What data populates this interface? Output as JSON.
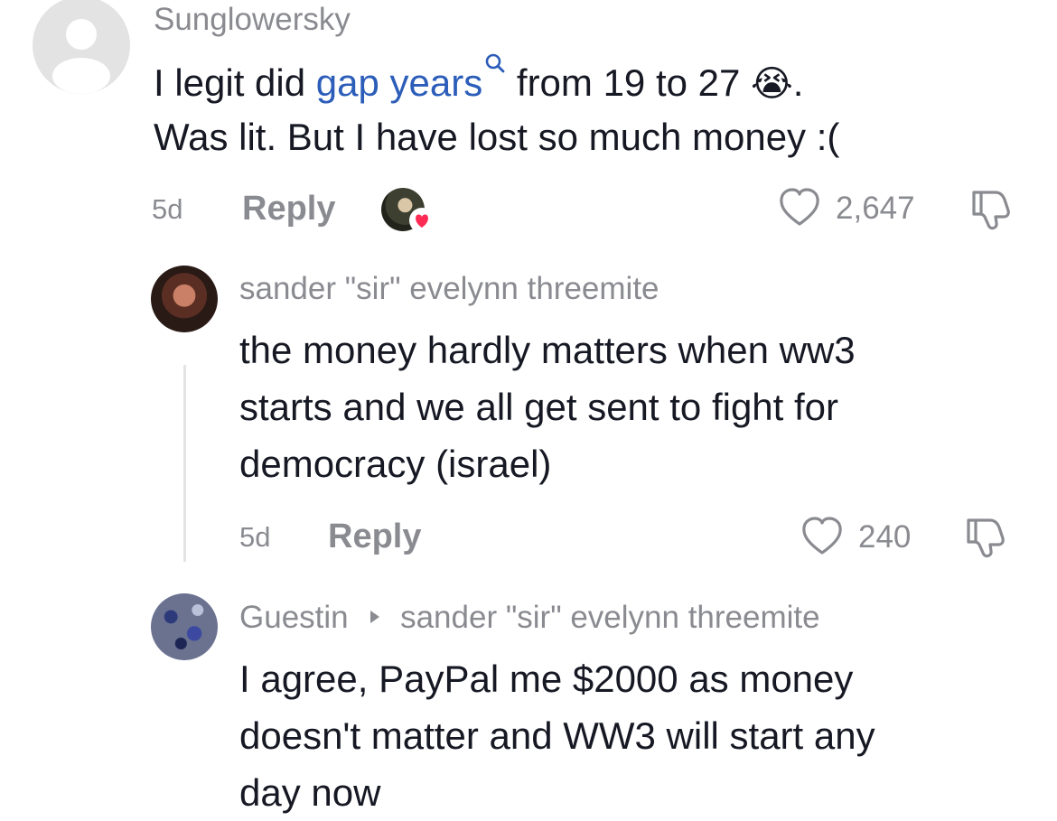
{
  "comments": [
    {
      "username": "Sunglowersky",
      "line1_prefix": "I legit did ",
      "link_text": "gap years",
      "line1_suffix": " from 19 to 27",
      "emoji": "😭",
      "line1_end": ".",
      "line2": "Was lit. But I have lost so much money :(",
      "time": "5d",
      "reply_label": "Reply",
      "likes": "2,647"
    },
    {
      "username": "sander \"sir\" evelynn threemite",
      "lines": [
        "the money hardly matters when ww3",
        "starts and we all get sent to fight for",
        "democracy (israel)"
      ],
      "time": "5d",
      "reply_label": "Reply",
      "likes": "240"
    },
    {
      "username": "Guestin",
      "reply_to": "sander \"sir\" evelynn threemite",
      "lines": [
        "I agree, PayPal me $2000 as money",
        "doesn't matter and WW3 will start any",
        "day now"
      ]
    }
  ],
  "icons": {
    "avatar_default": "default-avatar-icon",
    "search": "search-icon",
    "liked_by_creator": "creator-liked-avatar",
    "like": "heart-outline-icon",
    "dislike": "thumbs-down-icon",
    "reply_arrow": "triangle-right-icon"
  },
  "colors": {
    "link": "#2b5db9",
    "muted": "#8a8b91",
    "text": "#161823",
    "heart_badge": "#fe2c55"
  }
}
